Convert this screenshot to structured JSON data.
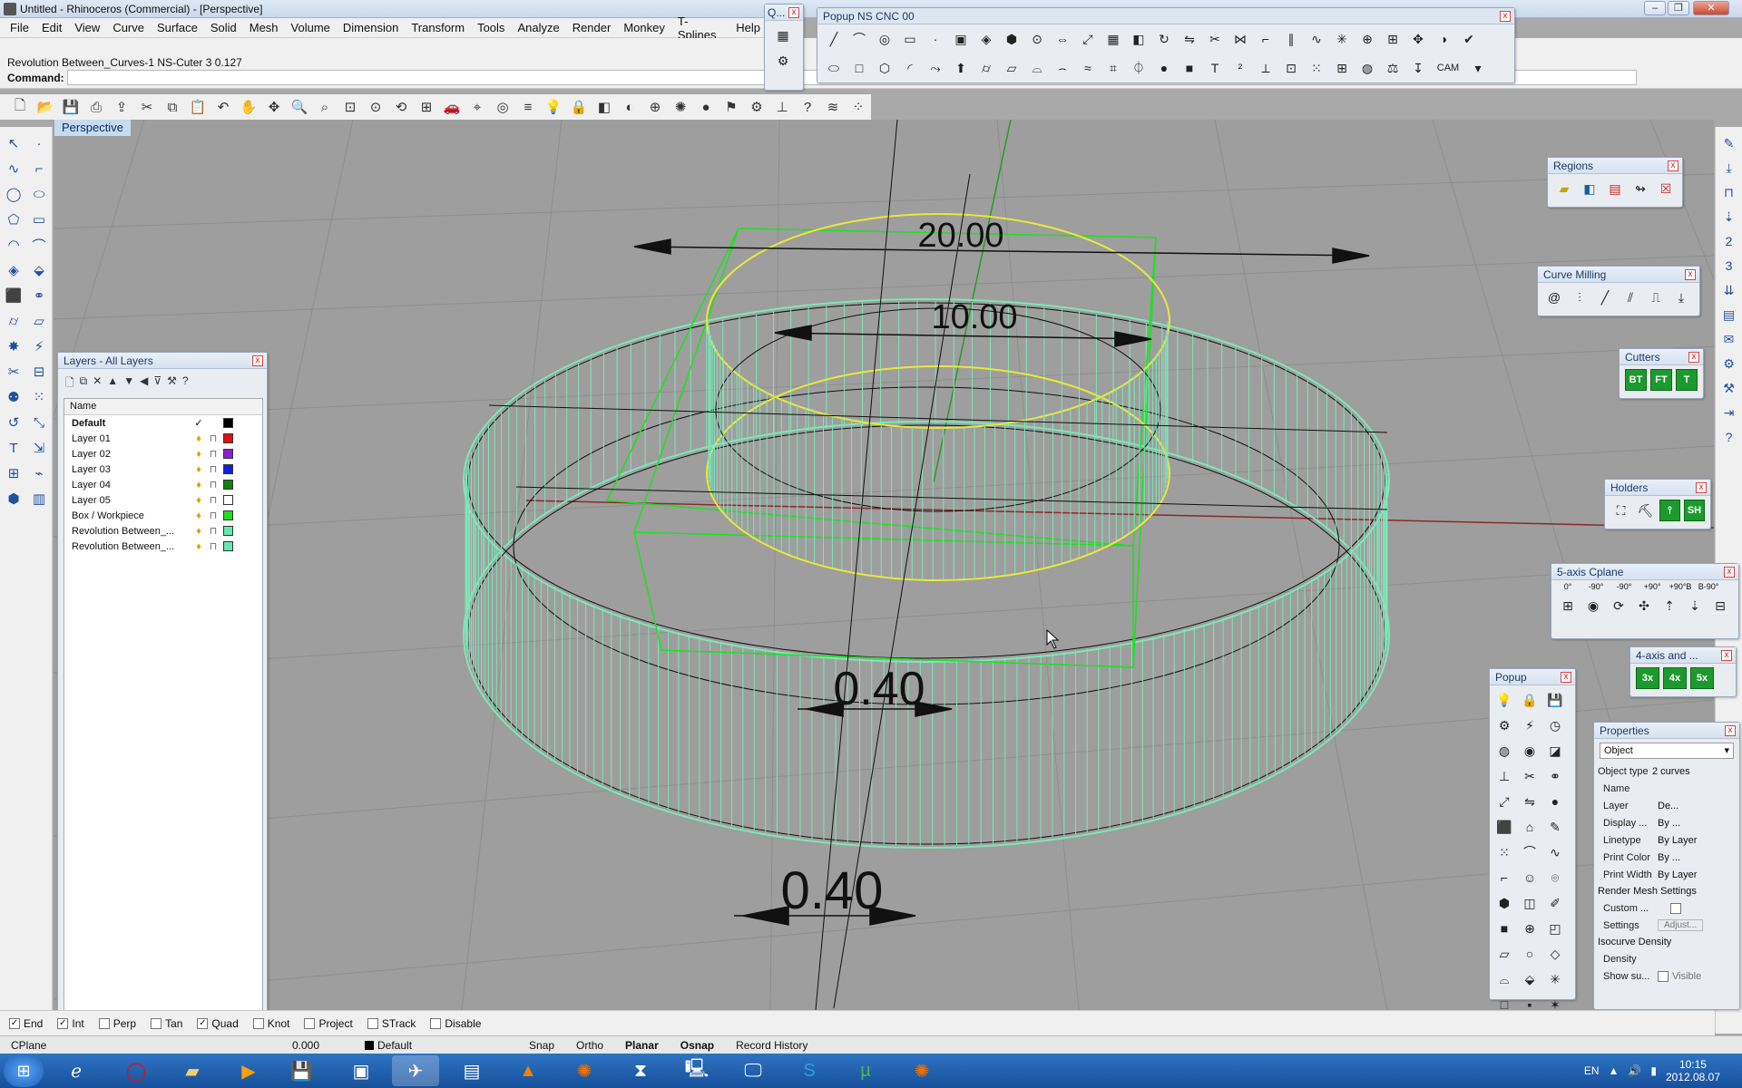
{
  "window": {
    "title": "Untitled - Rhinoceros (Commercial) - [Perspective]"
  },
  "menu": [
    "File",
    "Edit",
    "View",
    "Curve",
    "Surface",
    "Solid",
    "Mesh",
    "Volume",
    "Dimension",
    "Transform",
    "Tools",
    "Analyze",
    "Render",
    "Monkey",
    "T-Splines",
    "Help"
  ],
  "command": {
    "history": "Revolution Between_Curves-1 NS-Cuter 3  0.127",
    "label": "Command:",
    "value": ""
  },
  "viewport": {
    "title": "Perspective",
    "dimensions": [
      "20.00",
      "10.00",
      "0.40",
      "0.40"
    ]
  },
  "panels": {
    "q_title": "Q...",
    "popup_cnc_title": "Popup NS CNC 00",
    "popup_cnc_cam": "CAM",
    "regions_title": "Regions",
    "curve_milling_title": "Curve Milling",
    "cutters_title": "Cutters",
    "cutter_labels": [
      "BT",
      "FT",
      "T"
    ],
    "holders_title": "Holders",
    "holder_labels": [
      "SH"
    ],
    "cplane_title": "5-axis Cplane",
    "cplane_labels": [
      "0°",
      "-90°",
      "-90°",
      "+90°",
      "+90°B",
      "B-90°"
    ],
    "axis4_title": "4-axis and ...",
    "axis_buttons": [
      "3x",
      "4x",
      "5x"
    ],
    "popup_title": "Popup"
  },
  "layers": {
    "title": "Layers - All Layers",
    "column_name": "Name",
    "rows": [
      {
        "name": "Default",
        "current": "✓",
        "color": "#000000"
      },
      {
        "name": "Layer 01",
        "color": "#e01010"
      },
      {
        "name": "Layer 02",
        "color": "#8a1fd0"
      },
      {
        "name": "Layer 03",
        "color": "#1020e0"
      },
      {
        "name": "Layer 04",
        "color": "#108010"
      },
      {
        "name": "Layer 05",
        "color": "#ffffff"
      },
      {
        "name": "Box / Workpiece",
        "color": "#22dd22"
      },
      {
        "name": "Revolution Between_...",
        "color": "#66e8b0"
      },
      {
        "name": "Revolution Between_...",
        "color": "#66e8b0"
      }
    ]
  },
  "properties": {
    "title": "Properties",
    "dropdown": "Object",
    "object_type_label": "Object type",
    "object_type_value": "2 curves",
    "rows": [
      {
        "k": "Name",
        "v": ""
      },
      {
        "k": "Layer",
        "v": "De..."
      },
      {
        "k": "Display ...",
        "v": "By ..."
      },
      {
        "k": "Linetype",
        "v": "By Layer"
      },
      {
        "k": "Print Color",
        "v": "By ..."
      },
      {
        "k": "Print Width",
        "v": "By Layer"
      }
    ],
    "render_mesh_section": "Render Mesh Settings",
    "custom_label": "Custom ...",
    "settings_label": "Settings",
    "adjust_button": "Adjust...",
    "isocurve_section": "Isocurve Density",
    "density_label": "Density",
    "show_label": "Show su...",
    "visible_label": "Visible"
  },
  "osnap": [
    {
      "label": "End",
      "checked": true
    },
    {
      "label": "Int",
      "checked": true
    },
    {
      "label": "Perp",
      "checked": false
    },
    {
      "label": "Tan",
      "checked": false
    },
    {
      "label": "Quad",
      "checked": true
    },
    {
      "label": "Knot",
      "checked": false
    },
    {
      "label": "Project",
      "checked": false
    },
    {
      "label": "STrack",
      "checked": false
    },
    {
      "label": "Disable",
      "checked": false
    }
  ],
  "status": {
    "cplane": "CPlane",
    "coord": "0.000",
    "layer": "Default",
    "snap": "Snap",
    "ortho": "Ortho",
    "planar": "Planar",
    "osnap": "Osnap",
    "record": "Record History"
  },
  "tray": {
    "lang": "EN",
    "time": "10:15",
    "date": "2012.08.07"
  },
  "colors": {
    "curve_green": "#7fe6b9",
    "box_green": "#1fe01f",
    "yellow": "#e8e83a",
    "viewport_bg": "#9e9e9e"
  }
}
